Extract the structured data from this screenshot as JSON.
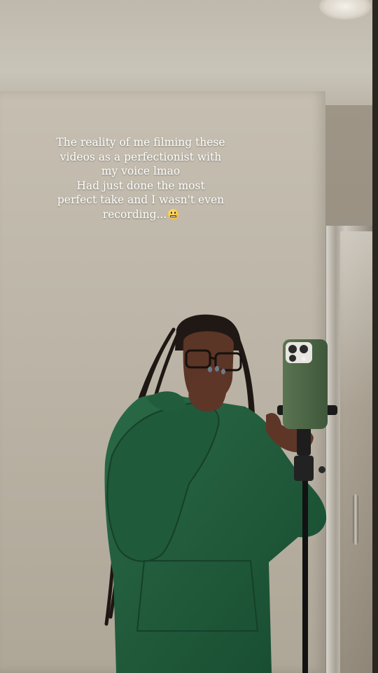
{
  "caption": {
    "lines": [
      "The reality of me filming these",
      "videos as a perfectionist with",
      "my voice lmao",
      "Had just done the most",
      "perfect take and I wasn't even",
      "recording..."
    ],
    "emoji": "grimacing-face-emoji"
  },
  "palette": {
    "wall": "#bdb6a8",
    "hoodie": "#1f5a3a",
    "phone_case": "#4f6a48",
    "caption_text": "#ffffff"
  }
}
